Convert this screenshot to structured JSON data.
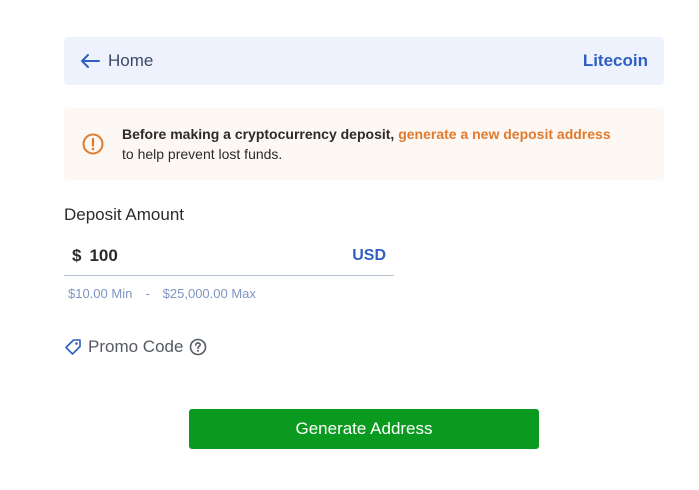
{
  "header": {
    "back_label": "Home",
    "crypto_name": "Litecoin"
  },
  "notice": {
    "strong_text": "Before making a cryptocurrency deposit,",
    "link_text": "generate a new deposit address",
    "rest_text": "to help prevent lost funds."
  },
  "deposit": {
    "label": "Deposit Amount",
    "currency_symbol": "$",
    "amount_value": "100",
    "currency_code": "USD",
    "min_label": "$10.00 Min",
    "separator": "-",
    "max_label": "$25,000.00 Max"
  },
  "promo": {
    "label": "Promo Code"
  },
  "actions": {
    "generate_label": "Generate Address"
  },
  "colors": {
    "accent_blue": "#2f5fc4",
    "warning_orange": "#e07a2f",
    "button_green": "#0a9a1f"
  },
  "icons": {
    "back": "arrow-left-icon",
    "notice": "exclamation-circle-icon",
    "promo": "tag-icon",
    "help": "question-circle-icon"
  }
}
